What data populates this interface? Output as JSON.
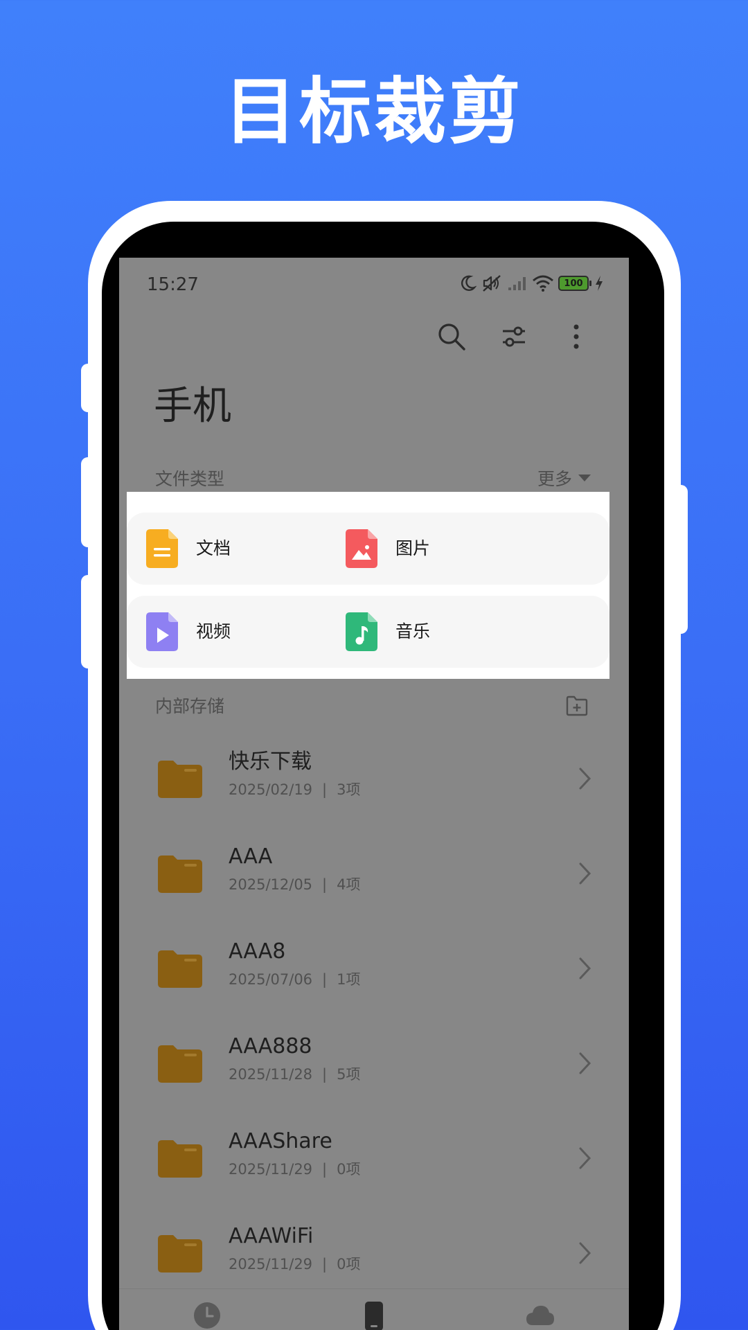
{
  "headline": "目标裁剪",
  "status_bar": {
    "time": "15:27",
    "battery_level": "100",
    "icons": [
      "moon-icon",
      "mute-icon",
      "signal-icon",
      "wifi-icon",
      "battery-icon",
      "charging-icon"
    ]
  },
  "toolbar": {
    "icons": [
      "search-icon",
      "filter-icon",
      "more-vertical-icon"
    ]
  },
  "page_title": "手机",
  "file_types": {
    "label": "文件类型",
    "more": "更多",
    "items": [
      {
        "label": "文档",
        "icon": "document-icon",
        "color": "#f7ad21"
      },
      {
        "label": "图片",
        "icon": "image-icon",
        "color": "#f45a5e"
      },
      {
        "label": "视频",
        "icon": "video-icon",
        "color": "#8e80f2"
      },
      {
        "label": "音乐",
        "icon": "music-icon",
        "color": "#2fb87a"
      }
    ]
  },
  "storage": {
    "label": "内部存储",
    "add_icon": "new-folder-icon",
    "folders": [
      {
        "name": "快乐下载",
        "date": "2025/02/19",
        "sep": "|",
        "count": "3项"
      },
      {
        "name": "AAA",
        "date": "2025/12/05",
        "sep": "|",
        "count": "4项"
      },
      {
        "name": "AAA8",
        "date": "2025/07/06",
        "sep": "|",
        "count": "1项"
      },
      {
        "name": "AAA888",
        "date": "2025/11/28",
        "sep": "|",
        "count": "5项"
      },
      {
        "name": "AAAShare",
        "date": "2025/11/29",
        "sep": "|",
        "count": "0项"
      },
      {
        "name": "AAAWiFi",
        "date": "2025/11/29",
        "sep": "|",
        "count": "0项"
      }
    ]
  },
  "bottom_nav": {
    "items": [
      "recent-icon",
      "phone-storage-icon",
      "cloud-icon"
    ]
  },
  "colors": {
    "background_top": "#4080fb",
    "background_bottom": "#2f56ef",
    "folder": "#8a5f12",
    "screen_overlay": "#878787"
  }
}
